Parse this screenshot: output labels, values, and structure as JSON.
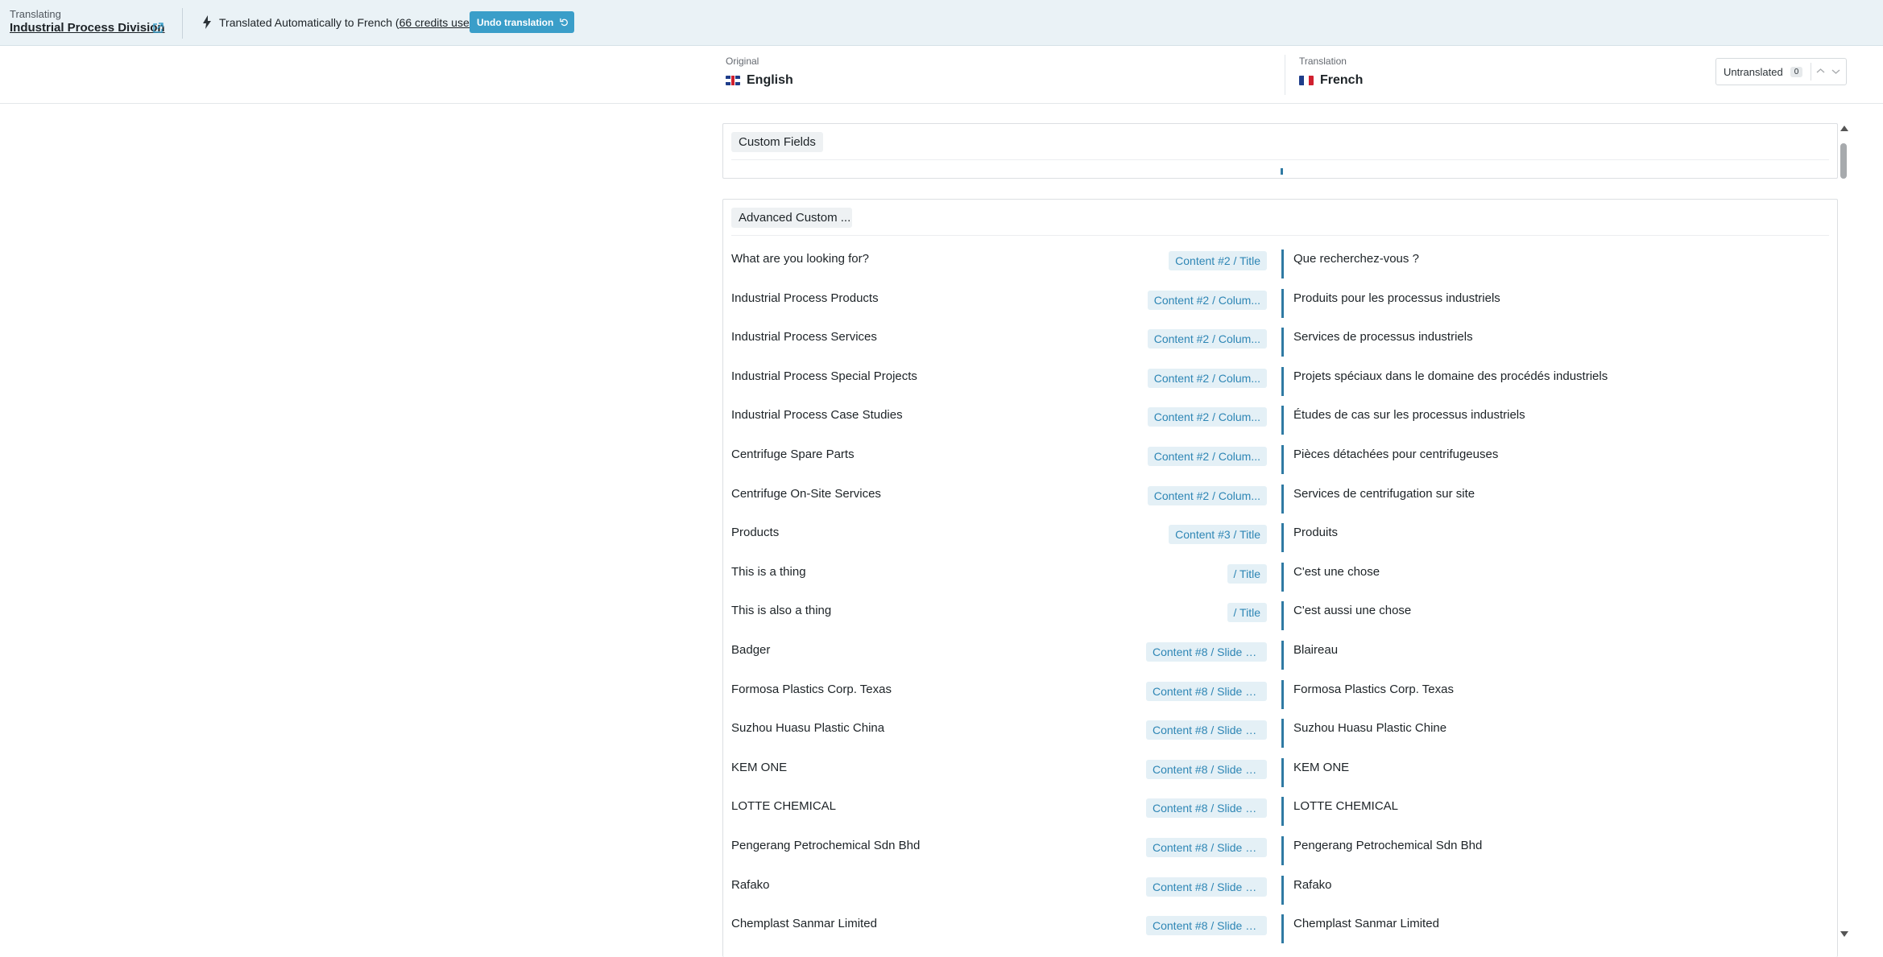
{
  "topbar": {
    "label": "Translating",
    "title": "Industrial Process Division",
    "status_prefix": "Translated Automatically to French (",
    "credits": "66 credits used",
    "status_suffix": ")",
    "undo_label": "Undo translation",
    "accent": "#3a9ec9"
  },
  "languages": {
    "original_label": "Original",
    "original_name": "English",
    "translation_label": "Translation",
    "translation_name": "French"
  },
  "filter": {
    "label": "Untranslated",
    "count": "0"
  },
  "sections": {
    "custom_fields": "Custom Fields",
    "advanced": "Advanced Custom ..."
  },
  "rows": [
    {
      "original": "What are you looking for?",
      "badge": "Content #2 / Title",
      "translation": "Que recherchez-vous ?"
    },
    {
      "original": "Industrial Process Products",
      "badge": "Content #2 / Colum...",
      "translation": "Produits pour les processus industriels"
    },
    {
      "original": "Industrial Process Services",
      "badge": "Content #2 / Colum...",
      "translation": "Services de processus industriels"
    },
    {
      "original": "Industrial Process Special Projects",
      "badge": "Content #2 / Colum...",
      "translation": "Projets spéciaux dans le domaine des procédés industriels"
    },
    {
      "original": "Industrial Process Case Studies",
      "badge": "Content #2 / Colum...",
      "translation": "Études de cas sur les processus industriels"
    },
    {
      "original": "Centrifuge Spare Parts",
      "badge": "Content #2 / Colum...",
      "translation": "Pièces détachées pour centrifugeuses"
    },
    {
      "original": "Centrifuge On-Site Services",
      "badge": "Content #2 / Colum...",
      "translation": "Services de centrifugation sur site"
    },
    {
      "original": "Products",
      "badge": "Content #3 / Title",
      "translation": "Produits"
    },
    {
      "original": "This is a thing",
      "badge": "/ Title",
      "translation": "C'est une chose"
    },
    {
      "original": "This is also a thing",
      "badge": "/ Title",
      "translation": "C'est aussi une chose"
    },
    {
      "original": "Badger",
      "badge": "Content #8 / Slide #...",
      "translation": "Blaireau"
    },
    {
      "original": "Formosa Plastics Corp. Texas",
      "badge": "Content #8 / Slide #...",
      "translation": "Formosa Plastics Corp. Texas"
    },
    {
      "original": "Suzhou Huasu Plastic China",
      "badge": "Content #8 / Slide #...",
      "translation": "Suzhou Huasu Plastic Chine"
    },
    {
      "original": "KEM ONE",
      "badge": "Content #8 / Slide #...",
      "translation": "KEM ONE"
    },
    {
      "original": "LOTTE CHEMICAL",
      "badge": "Content #8 / Slide #...",
      "translation": "LOTTE CHEMICAL"
    },
    {
      "original": "Pengerang Petrochemical Sdn Bhd",
      "badge": "Content #8 / Slide #...",
      "translation": "Pengerang Petrochemical Sdn Bhd"
    },
    {
      "original": "Rafako",
      "badge": "Content #8 / Slide #...",
      "translation": "Rafako"
    },
    {
      "original": "Chemplast Sanmar Limited",
      "badge": "Content #8 / Slide #...",
      "translation": "Chemplast Sanmar Limited"
    }
  ]
}
